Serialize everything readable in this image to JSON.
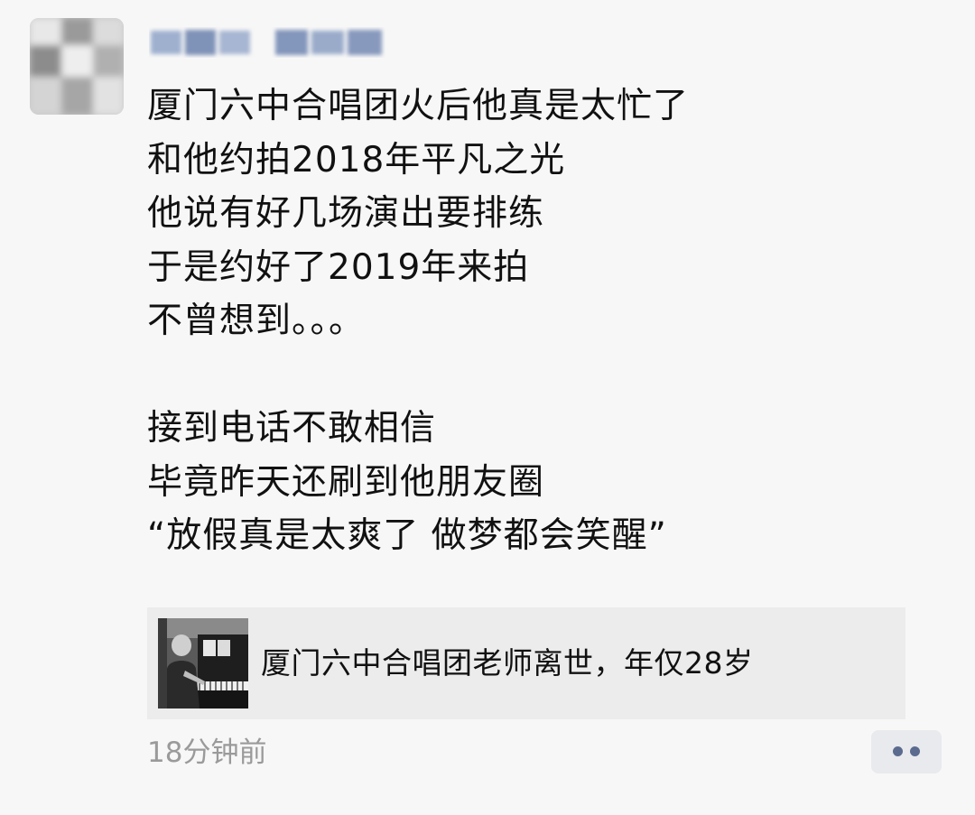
{
  "post": {
    "author_avatar": "blurred-avatar",
    "author_name": "",
    "lines": [
      "厦门六中合唱团火后他真是太忙了",
      "和他约拍2018年平凡之光",
      "他说有好几场演出要排练",
      "于是约好了2019年来拍",
      "不曾想到。。。",
      "",
      "接到电话不敢相信",
      "毕竟昨天还刷到他朋友圈",
      "“放假真是太爽了 做梦都会笑醒”",
      ""
    ],
    "emoji": [
      "🙏",
      "🙏",
      "🙏",
      "🙏",
      "🙏",
      "🙏"
    ],
    "link": {
      "title": "厦门六中合唱团老师离世，年仅28岁",
      "thumbnail": "piano-photo"
    },
    "timestamp": "18分钟前",
    "more_icon": "more-dots-icon"
  },
  "colors": {
    "background": "#f7f7f7",
    "text": "#111111",
    "timestamp": "#9a9a9a",
    "card": "#ececec",
    "more_button_bg": "#e9eaee",
    "more_dots": "#5b6b8f"
  }
}
